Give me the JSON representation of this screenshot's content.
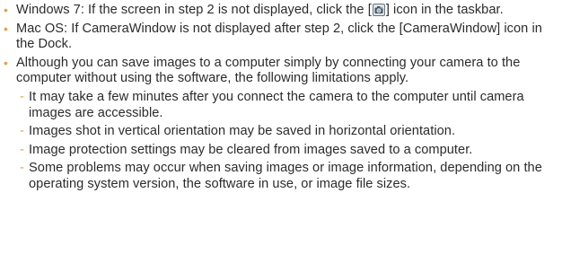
{
  "accent_color": "#e5a24a",
  "bullets": [
    {
      "text_before": "Windows 7: If the screen in step 2 is not displayed, click the ",
      "icon_name": "camera-window-icon",
      "text_after": " icon in the taskbar."
    },
    {
      "text": "Mac OS: If CameraWindow is not displayed after step 2, click the [CameraWindow] icon in the Dock."
    },
    {
      "text": "Although you can save images to a computer simply by connecting your camera to the computer without using the software, the following limitations apply."
    }
  ],
  "limitations": [
    "It may take a few minutes after you connect the camera to the computer until camera images are accessible.",
    "Images shot in vertical orientation may be saved in horizontal orientation.",
    "Image protection settings may be cleared from images saved to a computer.",
    "Some problems may occur when saving images or image information, depending on the operating system version, the software in use, or image file sizes."
  ]
}
